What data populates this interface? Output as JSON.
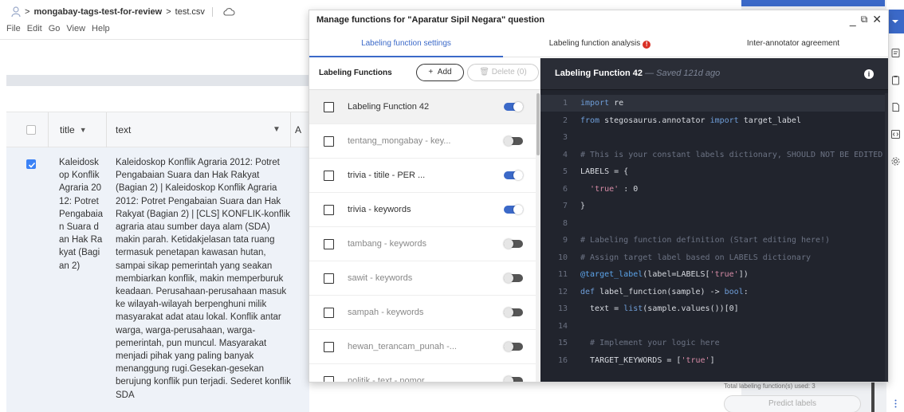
{
  "app": {
    "breadcrumb": [
      "mongabay-tags-test-for-review",
      "test.csv"
    ],
    "separator": ">",
    "menu": [
      "File",
      "Edit",
      "Go",
      "View",
      "Help"
    ]
  },
  "grid": {
    "columns": [
      "title",
      "text",
      "A"
    ],
    "row": {
      "checked": true,
      "title": "Kaleidoskop Konflik Agraria 2012: Potret Pengabaian Suara dan Hak Rakyat (Bagian 2)",
      "text": "Kaleidoskop Konflik Agraria 2012: Potret Pengabaian Suara dan Hak Rakyat (Bagian 2) | Kaleidoskop Konflik Agraria 2012: Potret Pengabaian Suara dan Hak Rakyat (Bagian 2) | [CLS] KONFLIK-konflik agraria atau sumber daya alam (SDA) makin parah. Ketidakjelasan tata ruang termasuk penetapan kawasan hutan, sampai sikap pemerintah yang seakan membiarkan konflik, makin memperburuk keadaan. Perusahaan-perusahaan masuk ke wilayah-wilayah berpenghuni milik masyarakat adat atau lokal. Konflik antar warga, warga-perusahaan, warga-pemerintah, pun muncul. Masyarakat menjadi pihak yang paling banyak menanggung rugi.Gesekan-gesekan berujung konflik pun terjadi. Sederet konflik SDA"
    }
  },
  "side_panel": {
    "used_text": "Total labeling function(s) used: 3",
    "predict_label": "Predict labels"
  },
  "modal": {
    "title": "Manage functions for \"Aparatur Sipil Negara\" question",
    "controls": {
      "minimize": "_",
      "restore": "⧉",
      "close": "✕"
    },
    "tabs": [
      "Labeling function settings",
      "Labeling function analysis",
      "Inter-annotator agreement"
    ],
    "active_tab": 0,
    "analysis_alert": "!",
    "list_header": "Labeling Functions",
    "add_label": "Add",
    "delete_label": "Delete (0)",
    "functions": [
      {
        "name": "Labeling Function 42",
        "enabled": true,
        "selected": true,
        "dim": false
      },
      {
        "name": "tentang_mongabay - key...",
        "enabled": false,
        "selected": false,
        "dim": true
      },
      {
        "name": "trivia - titile - PER ...",
        "enabled": true,
        "selected": false,
        "dim": false
      },
      {
        "name": "trivia - keywords",
        "enabled": true,
        "selected": false,
        "dim": false
      },
      {
        "name": "tambang - keywords",
        "enabled": false,
        "selected": false,
        "dim": true
      },
      {
        "name": "sawit - keywords",
        "enabled": false,
        "selected": false,
        "dim": true
      },
      {
        "name": "sampah - keywords",
        "enabled": false,
        "selected": false,
        "dim": true
      },
      {
        "name": "hewan_terancam_punah -...",
        "enabled": false,
        "selected": false,
        "dim": true
      },
      {
        "name": "politik - text - nomor",
        "enabled": false,
        "selected": false,
        "dim": true
      }
    ],
    "editor": {
      "title": "Labeling Function 42",
      "saved": "— Saved 121d ago",
      "info_icon": "i",
      "lines": [
        "import re",
        "from stegosaurus.annotator import target_label",
        "",
        "# This is your constant labels dictionary, SHOULD NOT BE EDITED",
        "LABELS = {",
        "  'true' : 0",
        "}",
        "",
        "# Labeling function definition (Start editing here!)",
        "# Assign target label based on LABELS dictionary",
        "@target_label(label=LABELS['true'])",
        "def label_function(sample) -> bool:",
        "  text = list(sample.values())[0]",
        "",
        "  # Implement your logic here",
        "  TARGET_KEYWORDS = ['true']"
      ]
    }
  },
  "colors": {
    "accent": "#3b69c8",
    "alert": "#d93025",
    "editor_bg": "#21242d"
  }
}
